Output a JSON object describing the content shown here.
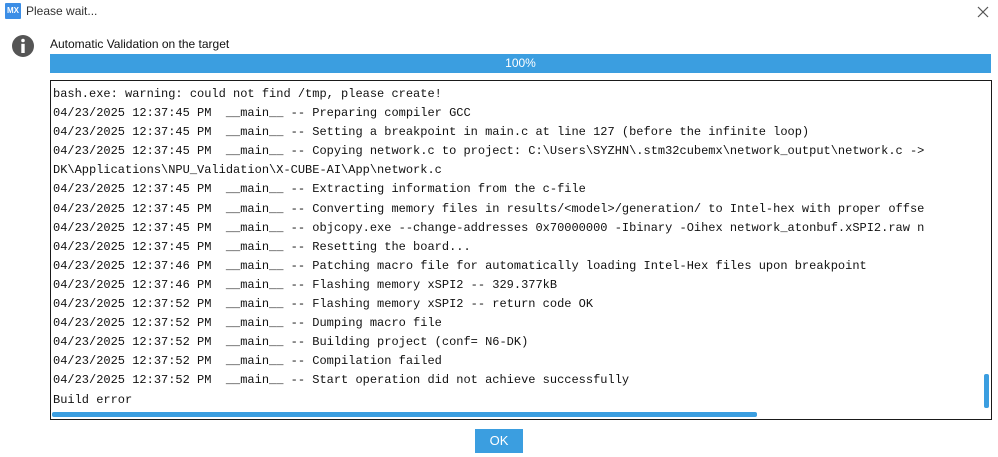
{
  "window": {
    "logo_text": "MX",
    "title": "Please wait..."
  },
  "header": {
    "label": "Automatic Validation on the target"
  },
  "progress": {
    "value": 100,
    "label": "100%"
  },
  "log": {
    "lines": [
      "bash.exe: warning: could not find /tmp, please create!",
      "04/23/2025 12:37:45 PM  __main__ -- Preparing compiler GCC",
      "04/23/2025 12:37:45 PM  __main__ -- Setting a breakpoint in main.c at line 127 (before the infinite loop)",
      "04/23/2025 12:37:45 PM  __main__ -- Copying network.c to project: C:\\Users\\SYZHN\\.stm32cubemx\\network_output\\network.c ->",
      "DK\\Applications\\NPU_Validation\\X-CUBE-AI\\App\\network.c",
      "04/23/2025 12:37:45 PM  __main__ -- Extracting information from the c-file",
      "04/23/2025 12:37:45 PM  __main__ -- Converting memory files in results/<model>/generation/ to Intel-hex with proper offse",
      "04/23/2025 12:37:45 PM  __main__ -- objcopy.exe --change-addresses 0x70000000 -Ibinary -Oihex network_atonbuf.xSPI2.raw n",
      "04/23/2025 12:37:45 PM  __main__ -- Resetting the board...",
      "04/23/2025 12:37:46 PM  __main__ -- Patching macro file for automatically loading Intel-Hex files upon breakpoint",
      "04/23/2025 12:37:46 PM  __main__ -- Flashing memory xSPI2 -- 329.377kB",
      "04/23/2025 12:37:52 PM  __main__ -- Flashing memory xSPI2 -- return code OK",
      "04/23/2025 12:37:52 PM  __main__ -- Dumping macro file",
      "04/23/2025 12:37:52 PM  __main__ -- Building project (conf= N6-DK)",
      "04/23/2025 12:37:52 PM  __main__ -- Compilation failed",
      "04/23/2025 12:37:52 PM  __main__ -- Start operation did not achieve successfully",
      "Build error"
    ],
    "vertical_scroll_fraction": 1.0,
    "horizontal_visible_fraction": 0.75
  },
  "buttons": {
    "ok_label": "OK"
  },
  "icons": {
    "app": "mx-logo-icon",
    "close": "close-icon",
    "info": "info-icon"
  },
  "colors": {
    "accent": "#3b9ee0",
    "track": "#e6e6e6",
    "info_icon": "#555555"
  }
}
